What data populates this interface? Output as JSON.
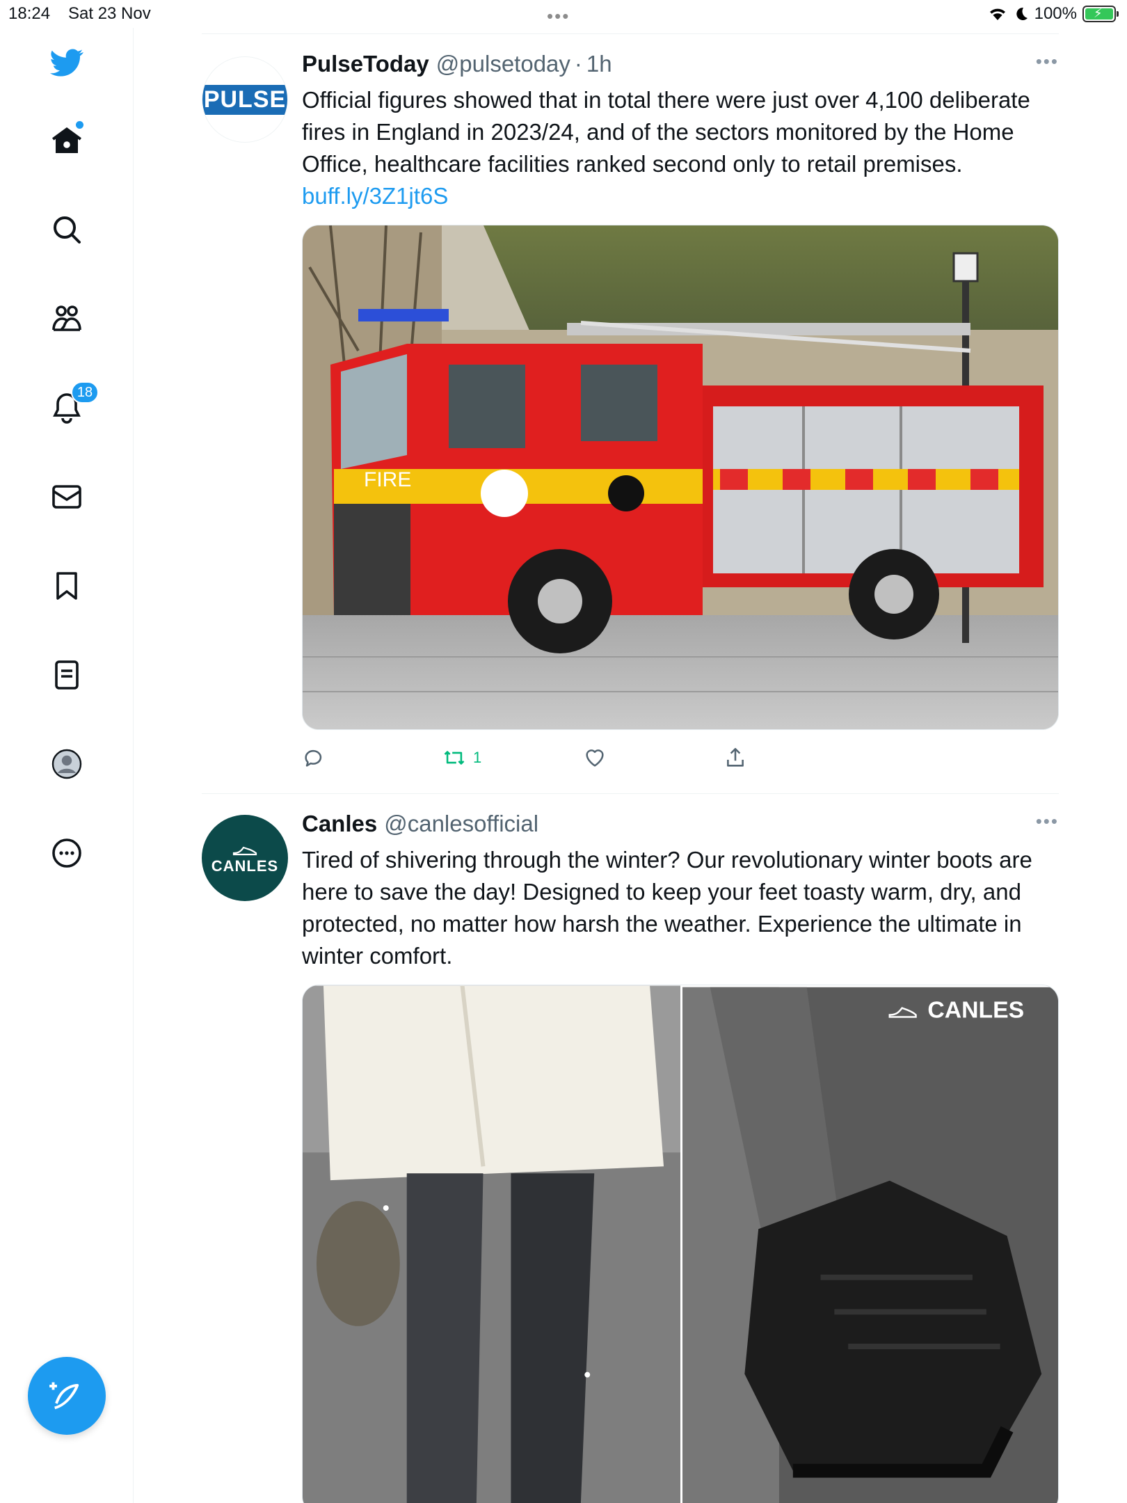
{
  "status_bar": {
    "time": "18:24",
    "date": "Sat 23 Nov",
    "battery": "100%"
  },
  "sidebar": {
    "notifications_count": "18",
    "accent": "#1d9bf0"
  },
  "tweets": [
    {
      "name": "PulseToday",
      "handle": "@pulsetoday",
      "sep": "·",
      "time": "1h",
      "avatar_text": "PULSE",
      "text": "Official figures showed that in total there were just over 4,100 deliberate fires in England in 2023/24, and of the sectors monitored by the Home Office, healthcare facilities ranked second only to retail premises. ",
      "link": "buff.ly/3Z1jt6S",
      "retweet_count": "1",
      "media_text": "FIRE"
    },
    {
      "name": "Canles",
      "handle": "@canlesofficial",
      "avatar_text": "CANLES",
      "text": "Tired of shivering through the winter? Our revolutionary winter boots are here to save the day! Designed to keep your feet toasty warm, dry, and protected, no matter how harsh the weather. Experience the ultimate in winter comfort.",
      "media_brand": "CANLES"
    }
  ]
}
